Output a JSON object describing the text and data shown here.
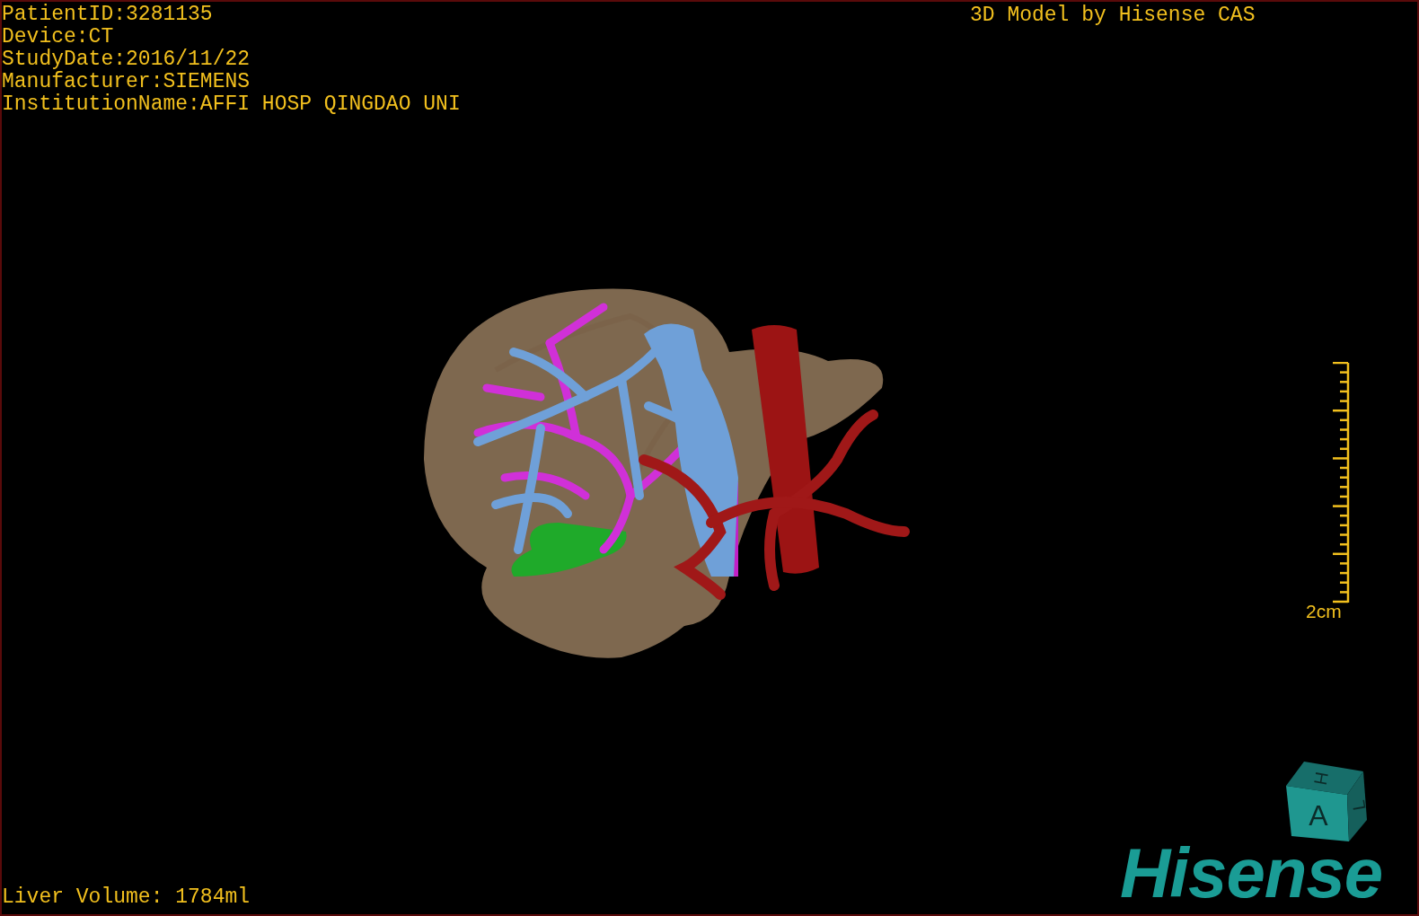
{
  "info_lines": [
    "PatientID:3281135",
    "Device:CT",
    "StudyDate:2016/11/22",
    "Manufacturer:SIEMENS",
    "InstitutionName:AFFI HOSP QINGDAO UNI"
  ],
  "title": "3D Model by Hisense CAS",
  "scale_bar": {
    "label": "2cm"
  },
  "orientation_cube": {
    "top": "H",
    "front": "A",
    "side": "L"
  },
  "logo": "Hisense",
  "liver_volume": "Liver Volume: 1784ml"
}
